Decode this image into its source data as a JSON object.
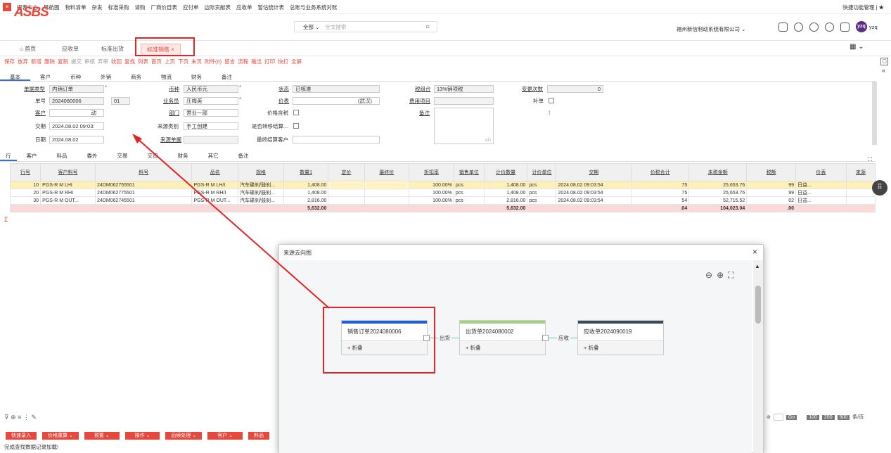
{
  "topmenu": [
    "报表中心",
    "导航图",
    "物料清单",
    "杂发",
    "标准采购",
    "请购",
    "厂商价目表",
    "应付单",
    "边际贡献表",
    "应收单",
    "暂估统计表",
    "总账与业务系统对账"
  ],
  "topright": "快捷功能管理",
  "logo": "ASBS",
  "search": {
    "scope": "全部",
    "placeholder": "全文搜索"
  },
  "company": "福州新信制动系统有限公司",
  "user": {
    "avatar": "yzq",
    "name": "yzq"
  },
  "tabs": [
    "首页",
    "应收单",
    "标准出货",
    "标准销售"
  ],
  "toolbar": [
    "保存",
    "放弃",
    "新增",
    "删除",
    "复制",
    "提交",
    "审核",
    "弃审",
    "收回",
    "复找",
    "列表",
    "首页",
    "上页",
    "下页",
    "末页",
    "附件(0)",
    "留言",
    "流程",
    "输出",
    "打印",
    "快打",
    "全屏"
  ],
  "formtabs": [
    "基本",
    "客户",
    "币种",
    "外销",
    "商务",
    "物流",
    "财务",
    "备注"
  ],
  "form": {
    "doc_type_label": "单据类型",
    "doc_type": "内销订单",
    "currency_label": "币种",
    "currency": "人民币元",
    "status_label": "状态",
    "status": "已核准",
    "tax_label": "税组合",
    "tax": "13%销项税",
    "changes_label": "变更次数",
    "changes": "0",
    "no_label": "单号",
    "no": "2024080006",
    "no_suffix": "01",
    "sales_label": "业务员",
    "sales": "庄梅英",
    "price_label": "价表",
    "price": "(武汉)",
    "cost_label": "费用项目",
    "supp_label": "补单",
    "cust_label": "客户",
    "cust": "动",
    "dept_label": "部门",
    "dept": "营业一部",
    "taxinc_label": "价格含税",
    "memo_label": "备注",
    "memo_ph": "ab",
    "delivery_label": "交期",
    "delivery": "2024.08.02 09:03:",
    "src_type_label": "来源类别",
    "src_type": "手工创建",
    "transfer_label": "是否转移结算...",
    "date_label": "日期",
    "date": "2024.08.02",
    "src_doc_label": "来源单据",
    "final_cust_label": "最终结算客户"
  },
  "gridtabs": [
    "行",
    "客户",
    "料品",
    "委外",
    "交易",
    "交货",
    "财务",
    "其它",
    "备注"
  ],
  "grid": {
    "headers": [
      "行号",
      "客户料号",
      "料号",
      "品名",
      "规格",
      "数量1",
      "定价",
      "最终价",
      "折扣率",
      "销售单位",
      "计价数量",
      "计价单位",
      "交期",
      "价税合计",
      "未税金额",
      "税额",
      "价表",
      "来源"
    ],
    "rows": [
      [
        "10",
        "PGS-R M LHI",
        "24DM062755501",
        "PGS-R M LH/I",
        "汽车碟刹/鼓刹...",
        "1,408.00",
        "",
        "",
        "100.00%",
        "pcs",
        "1,408.00",
        "pcs",
        "2024.08.02 09:03:54",
        "75",
        "25,653.76",
        "99",
        "日益..."
      ],
      [
        "20",
        "PGS-R M RHI",
        "24DM062775501",
        "PGS-R M RH/I",
        "汽车碟刹/鼓刹...",
        "1,408.00",
        "",
        "",
        "100.00%",
        "pcs",
        "1,408.00",
        "pcs",
        "2024.08.02 09:03:54",
        "75",
        "25,653.76",
        "99",
        "日益..."
      ],
      [
        "30",
        "PGS-R M OUT...",
        "24DM062745501",
        "PGS-R M OUT...",
        "汽车碟刹/鼓刹...",
        "2,816.00",
        "",
        "",
        "100.00%",
        "pcs",
        "2,816.00",
        "pcs",
        "2024.08.02 09:03:54",
        "54",
        "52,715.52",
        "02",
        "日益..."
      ]
    ],
    "sum": {
      "qty": "5,632.00",
      "pqty": "5,632.00",
      "total": ".04",
      "untaxed": "104,023.04",
      "tax": ".00"
    }
  },
  "bottom": [
    "快速录入",
    "价格重算",
    "预置",
    "操作",
    "后续处理",
    "客户",
    "料品"
  ],
  "status_text": "完成查找数据记录加载!",
  "pager": {
    "go": "Go",
    "sizes": [
      "100",
      "200",
      "500"
    ],
    "unit": "条/页"
  },
  "modal": {
    "title": "来源去向图",
    "nodes": [
      {
        "title": "销售订单2024080006",
        "fold": "折叠",
        "color": "#1f5fd6"
      },
      {
        "title": "出货单2024080002",
        "fold": "折叠",
        "color": "#a4cf83"
      },
      {
        "title": "应收单2024090019",
        "fold": "折叠",
        "color": "#3b4a5a"
      }
    ],
    "edges": [
      "出货",
      "应收"
    ]
  }
}
